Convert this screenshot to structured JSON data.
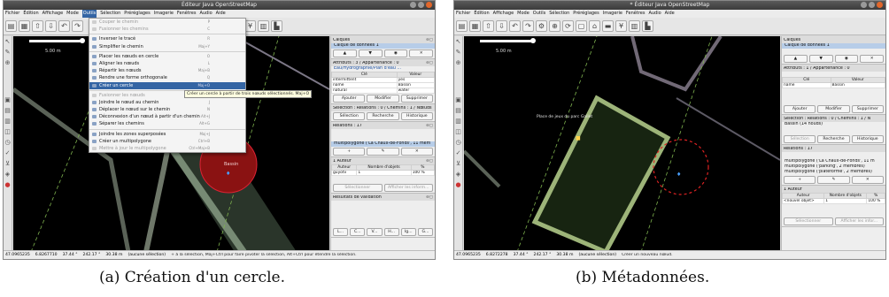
{
  "window": {
    "title": "Éditeur Java OpenStreetMap",
    "title_b": "* Éditeur Java OpenStreetMap"
  },
  "menubar": [
    "Fichier",
    "Édition",
    "Affichage",
    "Mode",
    "Outils",
    "Sélection",
    "Préréglages",
    "Imagerie",
    "Fenêtres",
    "Audio",
    "Aide"
  ],
  "map": {
    "scale": "5.00 m",
    "label_circle": "Bassin",
    "label_playground": "Place de jeux du parc Gallet"
  },
  "tools_menu": {
    "items": [
      {
        "label": "Couper le chemin",
        "shortcut": "P",
        "disabled": true
      },
      {
        "label": "Fusionner les chemins",
        "shortcut": "C",
        "disabled": true
      },
      {
        "label": "Inverser le tracé",
        "shortcut": "R",
        "disabled": false
      },
      {
        "label": "Simplifier le chemin",
        "shortcut": "Maj+Y",
        "disabled": false
      },
      {
        "label": "Placer les nœuds en cercle",
        "shortcut": "O",
        "disabled": false
      },
      {
        "label": "Aligner les nœuds",
        "shortcut": "L",
        "disabled": false
      },
      {
        "label": "Répartir les nœuds",
        "shortcut": "Maj+B",
        "disabled": false
      },
      {
        "label": "Rendre une forme orthogonale",
        "shortcut": "Q",
        "disabled": false
      },
      {
        "label": "Créer un cercle",
        "shortcut": "Maj+O",
        "disabled": false,
        "highlighted": true
      },
      {
        "label": "Fusionner les nœuds",
        "shortcut": "M",
        "disabled": true
      },
      {
        "label": "Joindre le nœud au chemin",
        "shortcut": "J",
        "disabled": false
      },
      {
        "label": "Déplacer le nœud sur le chemin",
        "shortcut": "N",
        "disabled": false
      },
      {
        "label": "Déconnexion d'un nœud à partir d'un chemin",
        "shortcut": "Alt+J",
        "disabled": false
      },
      {
        "label": "Séparer les chemins",
        "shortcut": "Alt+G",
        "disabled": false
      },
      {
        "label": "Joindre les zones superposées",
        "shortcut": "Maj+J",
        "disabled": false
      },
      {
        "label": "Créer un multipolygone",
        "shortcut": "Ctrl+B",
        "disabled": false
      },
      {
        "label": "Mettre à jour le multipolygone",
        "shortcut": "Ctrl+Maj+B",
        "disabled": true
      }
    ],
    "tooltip": "Créer un cercle à partir de trois nœuds sélectionnés. Maj+O"
  },
  "panel_a": {
    "layers": {
      "title": "Calques",
      "item": "Calque de données 1"
    },
    "attributes": {
      "title": "Attributs : 3 / Appartenance : 0",
      "preset": "Eau/Hydrographie/Plan d'eau ...",
      "headers": [
        "Clé",
        "Valeur"
      ],
      "rows": [
        [
          "intermittent",
          "yes"
        ],
        [
          "name",
          "Bassin"
        ],
        [
          "natural",
          "water"
        ]
      ],
      "buttons": [
        "Ajouter",
        "Modifier",
        "Supprimer"
      ]
    },
    "selection": {
      "title": "Sélection : Relations : 0 / Chemins : 1 / Nœuds",
      "buttons": [
        "Sélection",
        "Recherche",
        "Historique"
      ]
    },
    "relations": {
      "title": "Relations : 17",
      "item": "multipolygone ('La Chaux-de-Fonds', 11 mem"
    },
    "authors": {
      "title": "1 Auteur",
      "headers": [
        "Auteur",
        "Nombre d'objets",
        "%"
      ],
      "row": [
        "guyotv",
        "1",
        "100 %"
      ],
      "buttons": [
        "Sélectionner",
        "Afficher les inform..."
      ]
    },
    "validation": {
      "title": "Résultats de validation"
    },
    "bottom_buttons": [
      "L...",
      "C...",
      "V...",
      "H...",
      "Ig...",
      "G..."
    ]
  },
  "panel_b": {
    "layers": {
      "title": "Calques",
      "item": "Calque de données 1"
    },
    "attributes": {
      "title": "Attributs : 1 / Appartenance : 0",
      "headers": [
        "Clé",
        "Valeur"
      ],
      "rows": [
        [
          "name",
          "Bassin"
        ]
      ],
      "buttons": [
        "Ajouter",
        "Modifier",
        "Supprimer"
      ]
    },
    "selection": {
      "title": "Sélection : Relations : 0 / Chemins : 1 / N",
      "item": "Bassin (14 nouds)",
      "buttons": [
        "Sélection",
        "Recherche",
        "Historique"
      ]
    },
    "relations": {
      "title": "Relations : 17",
      "items": [
        "multipolygone ('La Chaux-de-Fonds', 11 m",
        "multipolygone ('parking', 2 membres)",
        "multipolygone ('plateforme', 2 membres)"
      ]
    },
    "authors": {
      "title": "1 Auteur",
      "headers": [
        "Auteur",
        "Nombre d'objets",
        "%"
      ],
      "row": [
        "<nouvel objet>",
        "1",
        "100 %"
      ],
      "buttons": [
        "Sélectionner",
        "Afficher les infor..."
      ]
    }
  },
  "status_a": {
    "lat": "47.0965235",
    "lon": "6.8267710",
    "angle": "37.44 °",
    "heading": "242.17 °",
    "dist": "30.38 m",
    "sel": "(aucune sélection)",
    "msg": "+ à la sélection, Maj+Ctrl pour faire pivoter la sélection, Alt+Ctrl pour étendre la sélection."
  },
  "status_b": {
    "lat": "47.0965235",
    "lon": "6.8272278",
    "angle": "37.44 °",
    "heading": "242.17 °",
    "dist": "30.38 m",
    "sel": "(aucune sélection)",
    "msg": "Créer un nouveau nœud."
  },
  "captions": {
    "a": "(a) Création d'un cercle.",
    "b": "(b) Métadonnées."
  }
}
